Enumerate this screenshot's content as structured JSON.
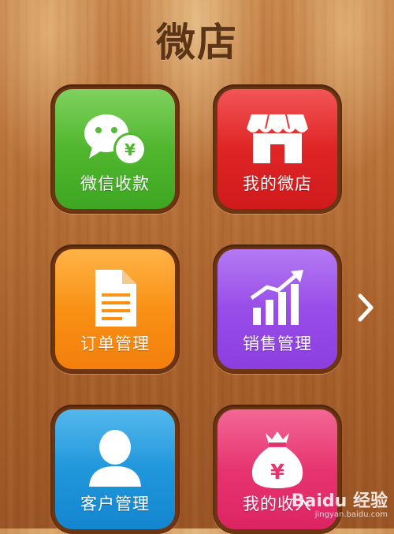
{
  "header": {
    "title": "微店"
  },
  "tiles": [
    {
      "label": "微信收款",
      "icon": "wechat-pay-icon"
    },
    {
      "label": "我的微店",
      "icon": "shop-icon"
    },
    {
      "label": "订单管理",
      "icon": "document-icon"
    },
    {
      "label": "销售管理",
      "icon": "sales-chart-icon"
    },
    {
      "label": "客户管理",
      "icon": "person-icon"
    },
    {
      "label": "我的收入",
      "icon": "money-bag-icon"
    }
  ],
  "navigation": {
    "next_icon": "chevron-right-icon"
  },
  "watermark": {
    "logo": "Baidu 经验",
    "url": "jingyan.baidu.com"
  },
  "colors": {
    "green": "#4fb52e",
    "red": "#e02426",
    "orange": "#f9900f",
    "purple": "#974bea",
    "blue": "#1f96dc",
    "pink": "#e83370"
  }
}
